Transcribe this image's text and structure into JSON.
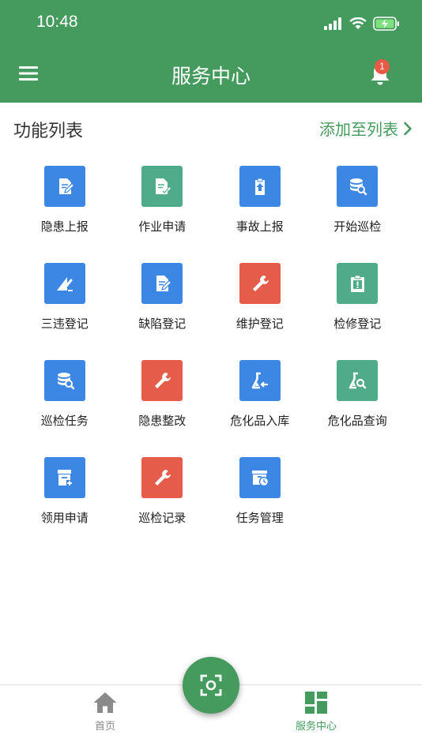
{
  "status_bar": {
    "time": "10:48"
  },
  "header": {
    "title": "服务中心",
    "notification_count": "1"
  },
  "section": {
    "title": "功能列表",
    "add_link": "添加至列表"
  },
  "colors": {
    "primary": "#459b5d",
    "blue": "#3d87e4",
    "teal": "#50ab8a",
    "red": "#e55d4a"
  },
  "functions": [
    {
      "label": "隐患上报",
      "icon": "edit-doc-icon",
      "color": "#3d87e4"
    },
    {
      "label": "作业申请",
      "icon": "doc-check-icon",
      "color": "#50ab8a"
    },
    {
      "label": "事故上报",
      "icon": "clipboard-upload-icon",
      "color": "#3d87e4"
    },
    {
      "label": "开始巡检",
      "icon": "database-search-icon",
      "color": "#3d87e4"
    },
    {
      "label": "三违登记",
      "icon": "warning-triangle-icon",
      "color": "#3d87e4"
    },
    {
      "label": "缺陷登记",
      "icon": "edit-doc-icon",
      "color": "#3d87e4"
    },
    {
      "label": "维护登记",
      "icon": "wrench-icon",
      "color": "#e55d4a"
    },
    {
      "label": "检修登记",
      "icon": "clipboard-alert-icon",
      "color": "#50ab8a"
    },
    {
      "label": "巡检任务",
      "icon": "database-search-icon",
      "color": "#3d87e4"
    },
    {
      "label": "隐患整改",
      "icon": "wrench-icon",
      "color": "#e55d4a"
    },
    {
      "label": "危化品入库",
      "icon": "flask-in-icon",
      "color": "#3d87e4"
    },
    {
      "label": "危化品查询",
      "icon": "flask-search-icon",
      "color": "#50ab8a"
    },
    {
      "label": "领用申请",
      "icon": "box-add-icon",
      "color": "#3d87e4"
    },
    {
      "label": "巡检记录",
      "icon": "wrench-icon",
      "color": "#e55d4a"
    },
    {
      "label": "任务管理",
      "icon": "archive-clock-icon",
      "color": "#3d87e4"
    }
  ],
  "tabbar": {
    "home_label": "首页",
    "service_label": "服务中心",
    "home_color": "#888888",
    "active_color": "#459b5d"
  }
}
